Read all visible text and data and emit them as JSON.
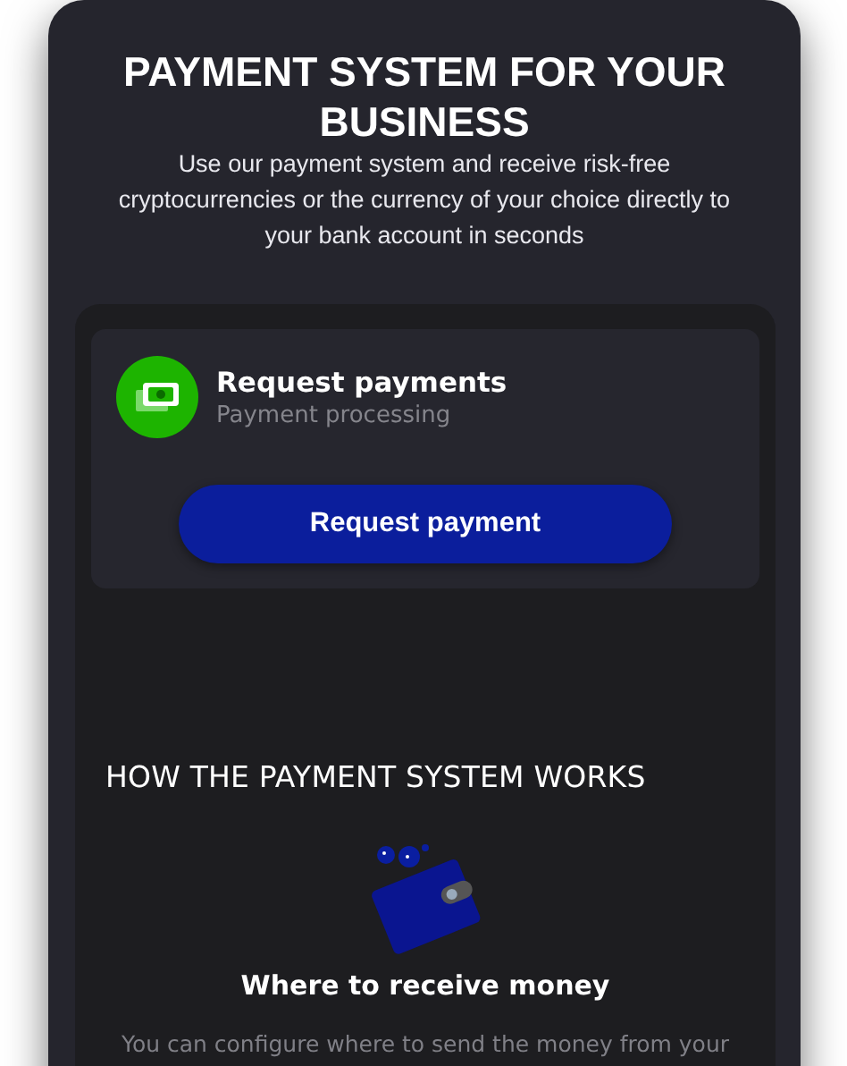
{
  "hero": {
    "title": "PAYMENT SYSTEM FOR YOUR BUSINESS",
    "subtitle": "Use our payment system and receive risk-free cryptocurrencies or the currency of your choice directly to your bank account in seconds"
  },
  "request_card": {
    "title": "Request payments",
    "subtitle": "Payment processing",
    "button": "Request payment"
  },
  "how_it_works": {
    "heading": "HOW THE PAYMENT SYSTEM WORKS",
    "steps": [
      {
        "title": "Where to receive money",
        "description": "You can configure where to send the money from your"
      }
    ]
  }
}
